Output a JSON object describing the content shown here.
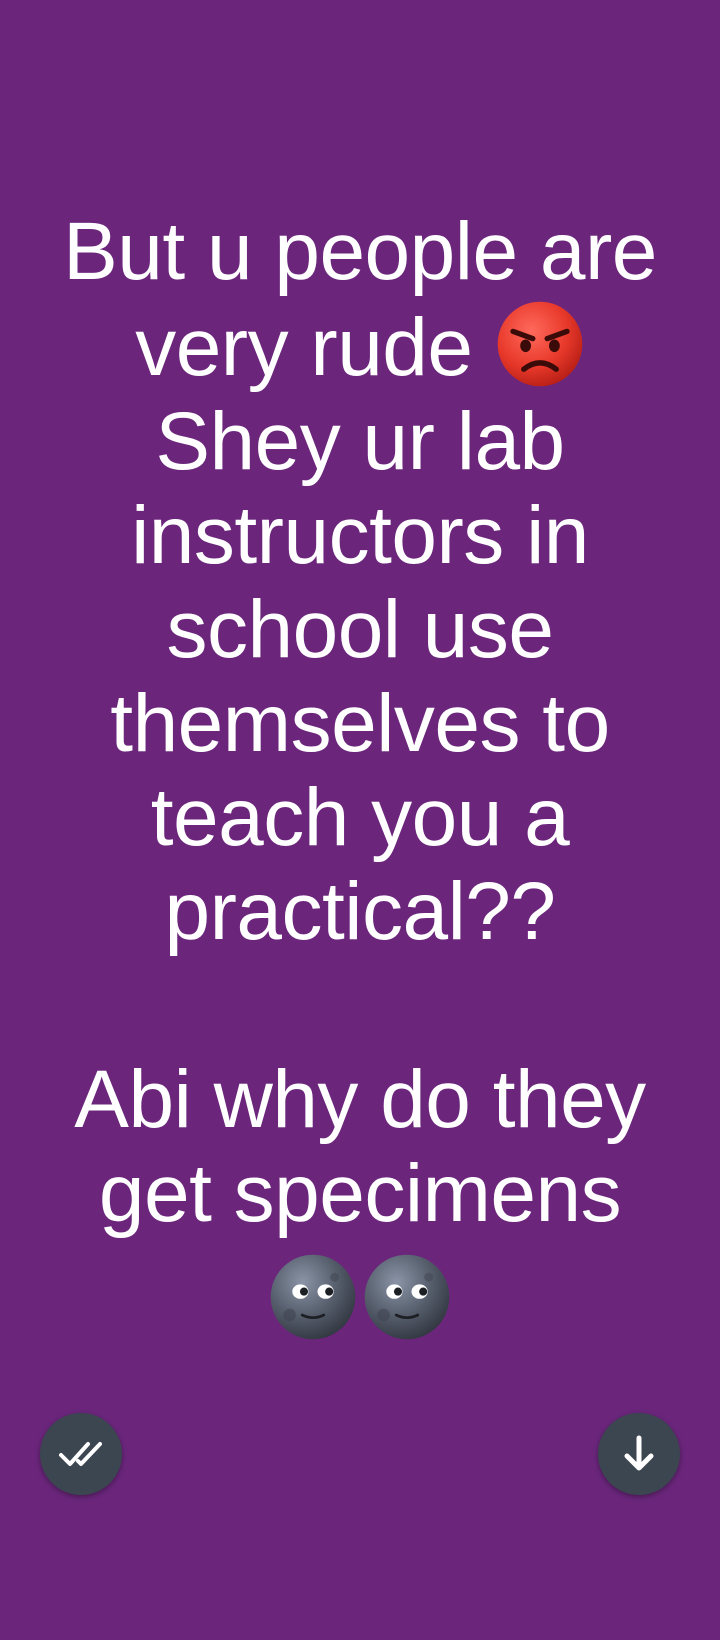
{
  "status": {
    "text_part1": "But u people are very rude ",
    "text_part2": "Shey ur lab instructors in school use themselves to teach you a practical??\n\nAbi why do they get specimens",
    "emoji_after_part1": "pouting-face-emoji",
    "emoji_after_part2": [
      "new-moon-face-emoji",
      "new-moon-face-emoji"
    ],
    "background_color": "#6b267c",
    "text_color": "#ffffff"
  },
  "controls": {
    "seen_icon": "double-check-icon",
    "download_icon": "arrow-down-icon",
    "button_color": "#3c4650"
  }
}
